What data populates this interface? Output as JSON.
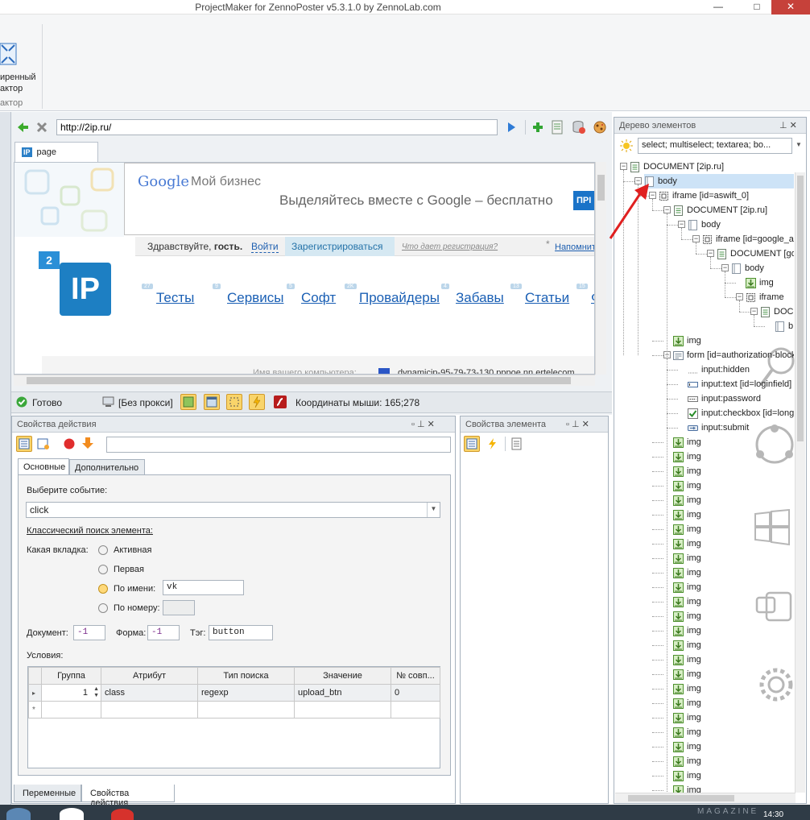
{
  "window": {
    "title": "ProjectMaker for ZennoPoster v5.3.1.0 by ZennoLab.com",
    "minimize": "—",
    "maximize": "□",
    "close": "✕"
  },
  "ribbon": {
    "button_line1": "иренный",
    "button_line2": "актор",
    "group_label": "актор"
  },
  "browser": {
    "url": "http://2ip.ru/",
    "tab_label": "page",
    "tab_badge": "IP",
    "web": {
      "google_brand": "Google",
      "google_product": "Мой бизнес",
      "ad_text": "Выделяйтесь вместе с Google – бесплатно",
      "ad_button": "ПРІ",
      "greeting": "Здравствуйте,",
      "guest": "гость.",
      "login": "Войти",
      "register": "Зарегистрироваться",
      "why_register": "Что дает регистрация?",
      "remind": "Напомнить",
      "logo_top": "2",
      "logo_main": "IP",
      "nav": [
        {
          "badge": "27",
          "label": "Тесты"
        },
        {
          "badge": "9",
          "label": "Сервисы"
        },
        {
          "badge": "5",
          "label": "Софт"
        },
        {
          "badge": "2K",
          "label": "Провайдеры"
        },
        {
          "badge": "4",
          "label": "Забавы"
        },
        {
          "badge": "13",
          "label": "Статьи"
        },
        {
          "badge": "15",
          "label": "Фо"
        }
      ],
      "bottom_text": "Имя вашего компьютера:",
      "bottom_value": "dynamicip-95-79-73-130.pppoe.nn.ertelecom"
    }
  },
  "status": {
    "ready": "Готово",
    "proxy": "[Без прокси]",
    "mouse": "Координаты мыши: 165;278"
  },
  "action_props": {
    "title": "Свойства действия",
    "tabs": [
      "Основные",
      "Дополнительно"
    ],
    "event_label": "Выберите событие:",
    "event_value": "click",
    "classic_search": "Классический поиск элемента:",
    "which_tab": "Какая вкладка:",
    "radio_active": "Активная",
    "radio_first": "Первая",
    "radio_by_name": "По имени:",
    "by_name_value": "vk",
    "radio_by_number": "По номеру:",
    "doc_label": "Документ:",
    "doc_value": "-1",
    "form_label": "Форма:",
    "form_value": "-1",
    "tag_label": "Тэг:",
    "tag_value": "button",
    "conditions": "Условия:",
    "grid": {
      "headers": [
        "Группа",
        "Атрибут",
        "Тип поиска",
        "Значение",
        "№ совп..."
      ],
      "rows": [
        [
          "1",
          "class",
          "regexp",
          "upload_btn",
          "0"
        ]
      ],
      "new_row_marker": "*",
      "current_row_marker": "▸"
    }
  },
  "element_props": {
    "title": "Свойства элемента"
  },
  "bottom_tabs": [
    "Переменные",
    "Свойства действия"
  ],
  "tree": {
    "title": "Дерево элементов",
    "filter": "select; multiselect; textarea; bo...",
    "nodes": [
      {
        "label": "DOCUMENT [2ip.ru]"
      },
      {
        "label": "body"
      },
      {
        "label": "iframe [id=aswift_0]"
      },
      {
        "label": "DOCUMENT [2ip.ru]"
      },
      {
        "label": "body"
      },
      {
        "label": "iframe [id=google_a"
      },
      {
        "label": "DOCUMENT [go"
      },
      {
        "label": "body"
      },
      {
        "label": "img"
      },
      {
        "label": "iframe"
      },
      {
        "label": "DOC"
      },
      {
        "label": "b"
      },
      {
        "label": "img"
      },
      {
        "label": "form [id=authorization-block]"
      },
      {
        "label": "input:hidden"
      },
      {
        "label": "input:text [id=loginfield]"
      },
      {
        "label": "input:password"
      },
      {
        "label": "input:checkbox [id=longSa"
      },
      {
        "label": "input:submit"
      }
    ],
    "img_label": "img"
  },
  "taskbar": {
    "clock": "14:30",
    "watermark": "MAGAZINE"
  }
}
